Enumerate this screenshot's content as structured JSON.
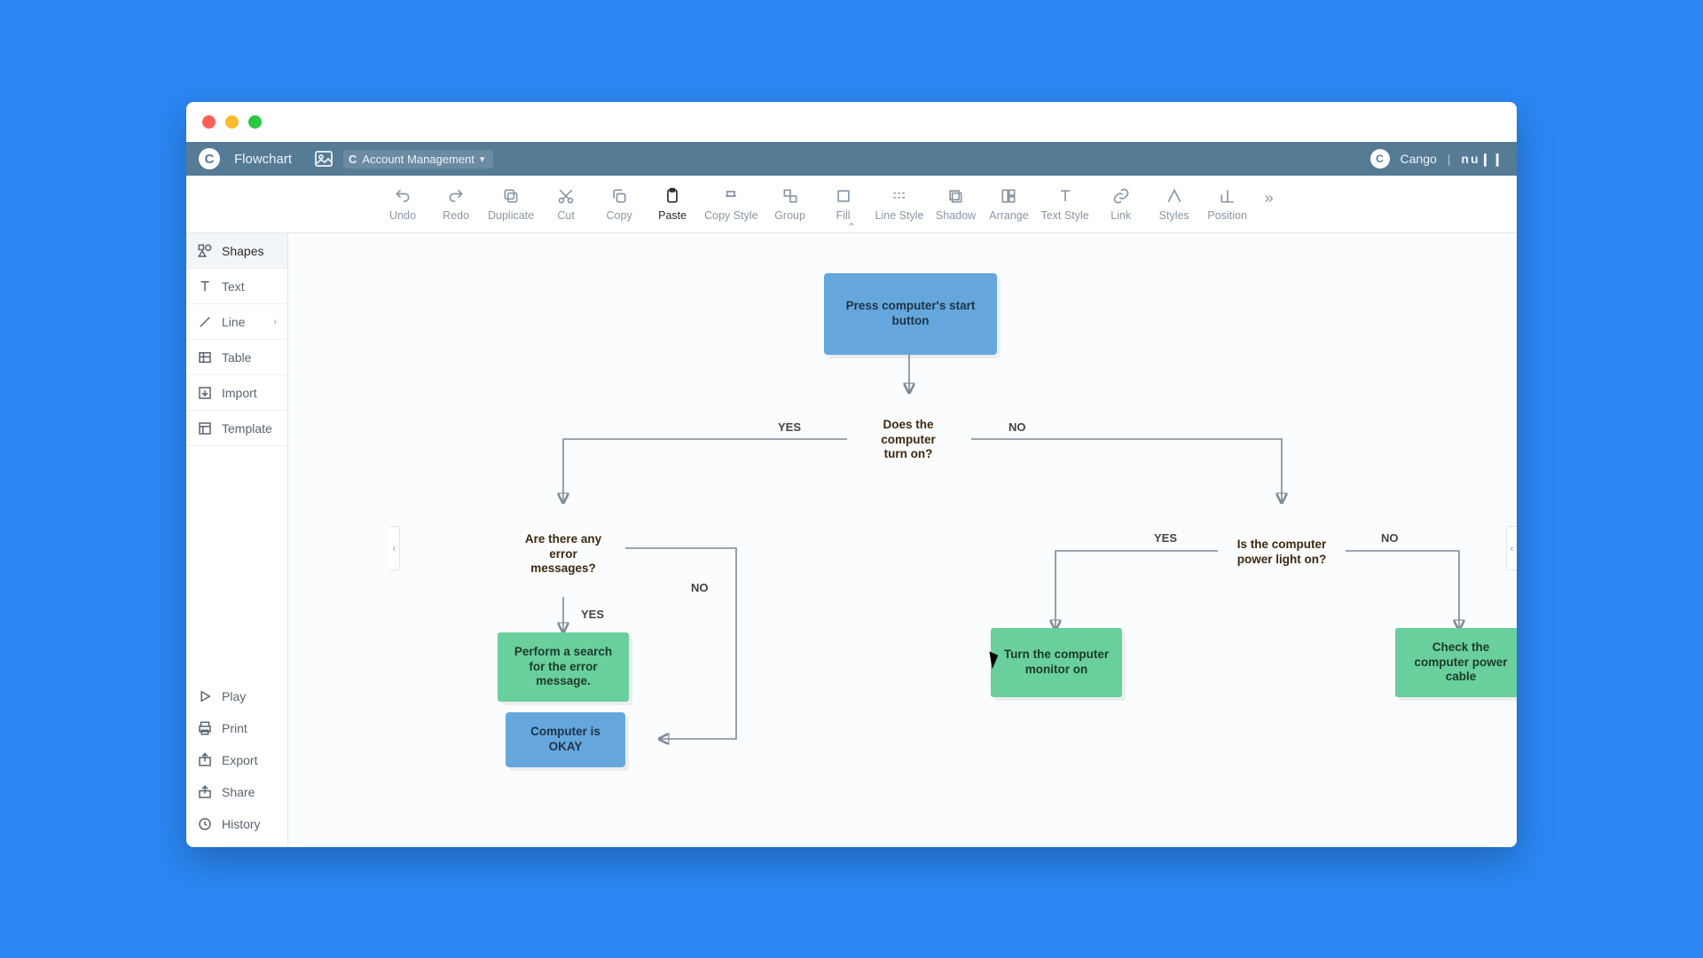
{
  "header": {
    "app_title": "Flowchart",
    "project_name": "Account Management",
    "user_name": "Cango",
    "brand": "nu❙❙"
  },
  "toolbar": {
    "items": [
      "Undo",
      "Redo",
      "Duplicate",
      "Cut",
      "Copy",
      "Paste",
      "Copy Style",
      "Group",
      "Fill",
      "Line Style",
      "Shadow",
      "Arrange",
      "Text Style",
      "Link",
      "Styles",
      "Position"
    ],
    "active_index": 5
  },
  "sidebar": {
    "top": [
      "Shapes",
      "Text",
      "Line",
      "Table",
      "Import",
      "Template"
    ],
    "top_active_index": 0,
    "bottom": [
      "Play",
      "Print",
      "Export",
      "Share",
      "History"
    ]
  },
  "flowchart": {
    "nodes": {
      "start": {
        "label": "Press computer's start button"
      },
      "turn_on": {
        "label": "Does the computer turn on?"
      },
      "error_msgs": {
        "label": "Are there any error messages?"
      },
      "power_light": {
        "label": "Is the computer power light on?"
      },
      "search_err": {
        "label": "Perform a search for the error message."
      },
      "ok": {
        "label": "Computer is OKAY"
      },
      "monitor_on": {
        "label": "Turn the computer monitor on"
      },
      "check_cable": {
        "label": "Check the computer power cable"
      }
    },
    "edge_labels": {
      "turn_on_yes": "YES",
      "turn_on_no": "NO",
      "errors_yes": "YES",
      "errors_no": "NO",
      "light_yes": "YES",
      "light_no": "NO"
    }
  }
}
